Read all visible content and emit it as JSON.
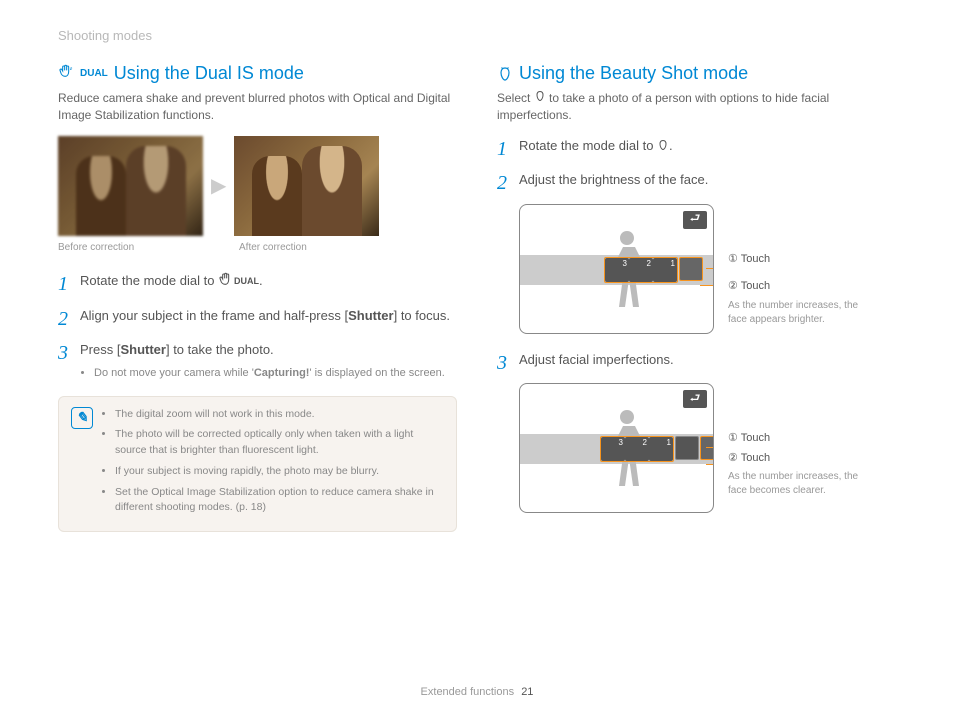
{
  "breadcrumb": "Shooting modes",
  "left": {
    "title": "Using the Dual IS mode",
    "icon_label": "DUAL",
    "intro": "Reduce camera shake and prevent blurred photos with Optical and Digital Image Stabilization functions.",
    "caption_before": "Before correction",
    "caption_after": "After correction",
    "steps": {
      "s1_pre": "Rotate the mode dial to ",
      "s1_icon_label": "DUAL",
      "s1_post": ".",
      "s2_pre": "Align your subject in the frame and half-press [",
      "s2_bold": "Shutter",
      "s2_post": "] to focus.",
      "s3_pre": "Press [",
      "s3_bold": "Shutter",
      "s3_post": "] to take the photo.",
      "s3_sub_pre": "Do not move your camera while '",
      "s3_sub_bold": "Capturing!",
      "s3_sub_post": "' is displayed on the screen."
    },
    "notes": [
      "The digital zoom will not work in this mode.",
      "The photo will be corrected optically only when taken with a light source that is brighter than fluorescent light.",
      "If your subject is moving rapidly, the photo may be blurry.",
      "Set the Optical Image Stabilization option to reduce camera shake in different shooting modes. (p. 18)"
    ]
  },
  "right": {
    "title": "Using the Beauty Shot mode",
    "intro_pre": "Select ",
    "intro_post": " to take a photo of a person with options to hide facial imperfections.",
    "steps": {
      "s1_pre": "Rotate the mode dial to ",
      "s1_post": ".",
      "s2": "Adjust the brightness of the face.",
      "s3": "Adjust facial imperfections."
    },
    "screen1": {
      "callout1": "Touch",
      "callout2": "Touch",
      "sub": "As the number increases, the face appears brighter."
    },
    "screen2": {
      "callout1": "Touch",
      "callout2": "Touch",
      "sub": "As the number increases, the face becomes clearer."
    }
  },
  "footer": {
    "section": "Extended functions",
    "page": "21"
  }
}
